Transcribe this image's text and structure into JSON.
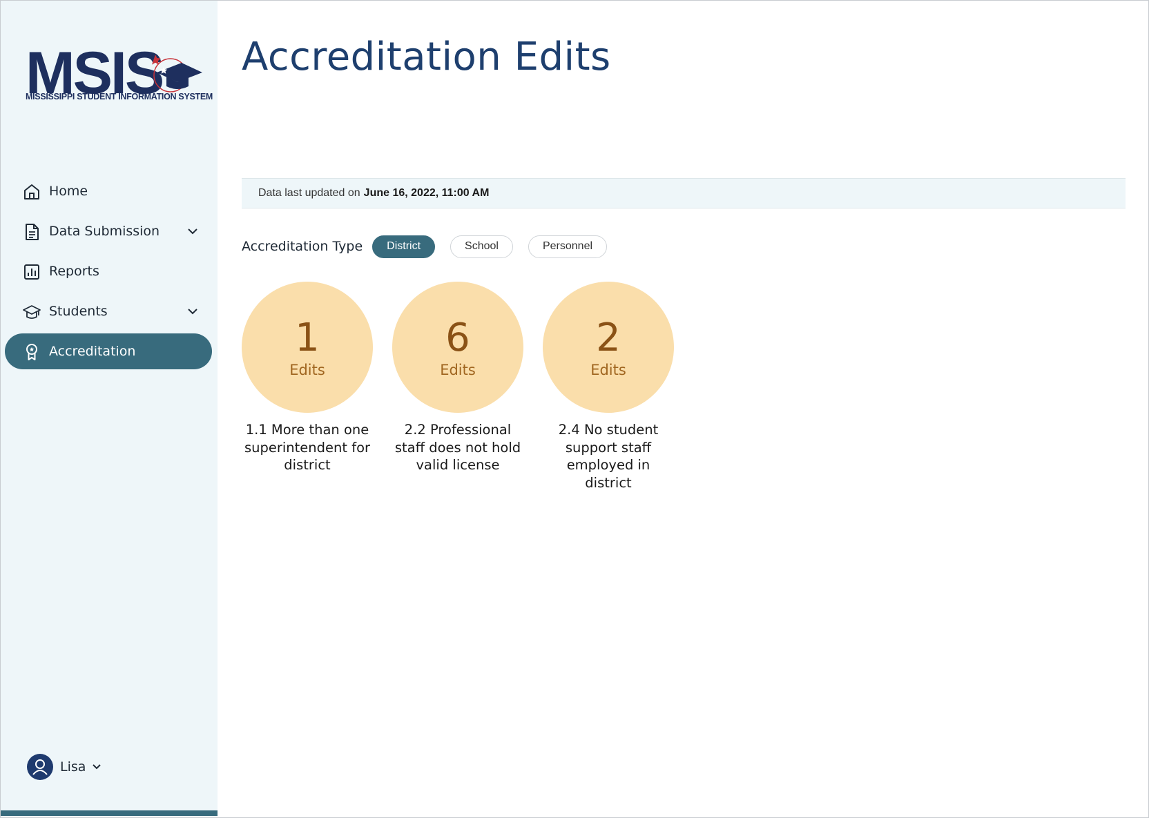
{
  "brand": {
    "logo_text": "MSIS",
    "logo_subtitle": "MISSISSIPPI STUDENT INFORMATION SYSTEM"
  },
  "sidebar": {
    "items": [
      {
        "label": "Home",
        "icon": "home-icon",
        "expandable": false,
        "active": false
      },
      {
        "label": "Data Submission",
        "icon": "document-icon",
        "expandable": true,
        "active": false
      },
      {
        "label": "Reports",
        "icon": "bar-chart-icon",
        "expandable": false,
        "active": false
      },
      {
        "label": "Students",
        "icon": "graduation-cap-icon",
        "expandable": true,
        "active": false
      },
      {
        "label": "Accreditation",
        "icon": "award-ribbon-icon",
        "expandable": false,
        "active": true
      }
    ],
    "user": {
      "name": "Lisa",
      "icon": "user-avatar-icon"
    }
  },
  "main": {
    "title": "Accreditation Edits",
    "update": {
      "prefix": "Data last updated on",
      "timestamp": "June 16, 2022, 11:00 AM"
    },
    "accreditation_type": {
      "label": "Accreditation Type",
      "options": [
        "District",
        "School",
        "Personnel"
      ],
      "selected": "District"
    },
    "edit_cards": [
      {
        "count": "1",
        "unit": "Edits",
        "description": "1.1 More than one superintendent for district"
      },
      {
        "count": "6",
        "unit": "Edits",
        "description": "2.2 Professional staff does not hold valid license"
      },
      {
        "count": "2",
        "unit": "Edits",
        "description": "2.4 No student support staff employed in district"
      }
    ]
  },
  "colors": {
    "sidebar_bg": "#eef6f9",
    "accent": "#386b7d",
    "title": "#1e3f6e",
    "circle_bg": "#fadeab",
    "circle_text": "#8a5216",
    "brand_navy": "#1e2f5e",
    "brand_red": "#c8333a"
  }
}
